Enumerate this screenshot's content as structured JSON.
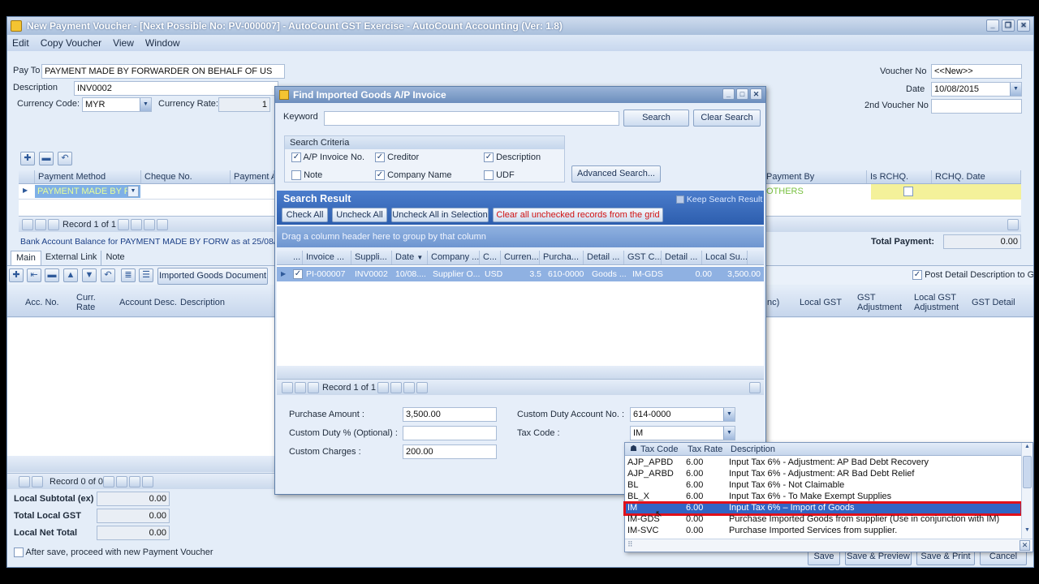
{
  "window": {
    "title": "New Payment Voucher - [Next Possible No: PV-000007] - AutoCount GST Exercise - AutoCount Accounting (Ver: 1.8)"
  },
  "menu": [
    "Edit",
    "Copy Voucher",
    "View",
    "Window"
  ],
  "header": {
    "pay_to_label": "Pay To",
    "pay_to_value": "PAYMENT MADE BY FORWARDER ON BEHALF OF US",
    "description_label": "Description",
    "description_value": "INV0002",
    "currency_code_label": "Currency Code:",
    "currency_code_value": "MYR",
    "currency_rate_label": "Currency Rate:",
    "currency_rate_value": "1",
    "voucher_no_label": "Voucher No",
    "voucher_no_value": "<<New>>",
    "date_label": "Date",
    "date_value": "10/08/2015",
    "second_voucher_label": "2nd Voucher No",
    "second_voucher_value": ""
  },
  "payment_grid": {
    "left_columns": [
      "Payment Method",
      "Cheque No.",
      "Payment Am"
    ],
    "right_columns": [
      "Payment By",
      "Is RCHQ.",
      "RCHQ. Date"
    ],
    "row_method": "PAYMENT MADE BY F...",
    "row_payment_by": "OTHERS",
    "record": "Record 1 of 1"
  },
  "bank_balance_text": "Bank Account Balance for PAYMENT MADE BY FORW as at 25/08/201",
  "total_payment_label": "Total Payment:",
  "total_payment_value": "0.00",
  "tabs": [
    "Main",
    "External Link",
    "Note"
  ],
  "detail_toolbar": {
    "imported_goods_button": "Imported Goods Document",
    "post_detail_label": "Post Detail Description to G/L"
  },
  "detail_grid": {
    "left_columns": [
      "Acc. No.",
      "Curr. Rate",
      "Account Desc.",
      "Description"
    ],
    "right_columns": [
      "nc)",
      "Local GST",
      "GST Adjustment",
      "Local GST Adjustment",
      "GST Detail"
    ],
    "record": "Record 0 of 0"
  },
  "totals": [
    {
      "label": "Local Subtotal (ex)",
      "value": "0.00"
    },
    {
      "label": "Total Local GST",
      "value": "0.00"
    },
    {
      "label": "Local Net Total",
      "value": "0.00"
    }
  ],
  "after_save_label": "After save, proceed with new Payment Voucher",
  "footer_buttons": [
    "Save",
    "Save & Preview",
    "Save & Print",
    "Cancel"
  ],
  "dialog": {
    "title": "Find Imported Goods A/P Invoice",
    "keyword_label": "Keyword",
    "keyword_value": "",
    "search_button": "Search",
    "clear_search_button": "Clear Search",
    "criteria_title": "Search Criteria",
    "criteria": [
      {
        "label": "A/P Invoice No.",
        "checked": true
      },
      {
        "label": "Creditor",
        "checked": true
      },
      {
        "label": "Description",
        "checked": true
      },
      {
        "label": "Note",
        "checked": false
      },
      {
        "label": "Company Name",
        "checked": true
      },
      {
        "label": "UDF",
        "checked": false
      }
    ],
    "advanced_search_button": "Advanced Search...",
    "search_result_title": "Search Result",
    "keep_search_result_label": "Keep Search Result",
    "check_all": "Check All",
    "uncheck_all": "Uncheck All",
    "uncheck_all_selection": "Uncheck All in Selection",
    "clear_unchecked": "Clear all unchecked records from the grid",
    "group_hint": "Drag a column header here to group by that column",
    "columns": [
      "...",
      "Invoice ...",
      "Suppli...",
      "Date",
      "Company ...",
      "C...",
      "Curren...",
      "Purcha...",
      "Detail ...",
      "GST C...",
      "Detail ...",
      "Local Su..."
    ],
    "row": [
      "",
      "PI-000007",
      "INV0002",
      "10/08....",
      "Supplier O...",
      "USD",
      "3.5",
      "610-0000",
      "Goods ...",
      "IM-GDS",
      "0.00",
      "3,500.00"
    ],
    "record": "Record 1 of 1",
    "purchase_amount_label": "Purchase Amount :",
    "purchase_amount_value": "3,500.00",
    "custom_duty_pct_label": "Custom Duty % (Optional) :",
    "custom_duty_pct_value": "",
    "custom_charges_label": "Custom Charges :",
    "custom_charges_value": "200.00",
    "custom_duty_account_label": "Custom Duty Account No. :",
    "custom_duty_account_value": "614-0000",
    "tax_code_label": "Tax Code :",
    "tax_code_value": "IM"
  },
  "tax_popup": {
    "columns": [
      "Tax Code",
      "Tax Rate",
      "Description"
    ],
    "rows": [
      {
        "code": "AJP_APBD",
        "rate": "6.00",
        "desc": "Input Tax 6% - Adjustment: AP Bad Debt Recovery"
      },
      {
        "code": "AJP_ARBD",
        "rate": "6.00",
        "desc": "Input Tax 6% - Adjustment: AR Bad Debt Relief"
      },
      {
        "code": "BL",
        "rate": "6.00",
        "desc": "Input Tax 6% - Not Claimable"
      },
      {
        "code": "BL_X",
        "rate": "6.00",
        "desc": "Input Tax 6% - To Make Exempt Supplies"
      },
      {
        "code": "IM",
        "rate": "6.00",
        "desc": "Input Tax 6% – Import of Goods"
      },
      {
        "code": "IM-GDS",
        "rate": "0.00",
        "desc": "Purchase Imported Goods from supplier (Use in conjunction with IM)"
      },
      {
        "code": "IM-SVC",
        "rate": "0.00",
        "desc": "Purchase Imported Services from supplier."
      }
    ],
    "highlight_color": "#e0101a",
    "selected_color": "#3165c5"
  }
}
